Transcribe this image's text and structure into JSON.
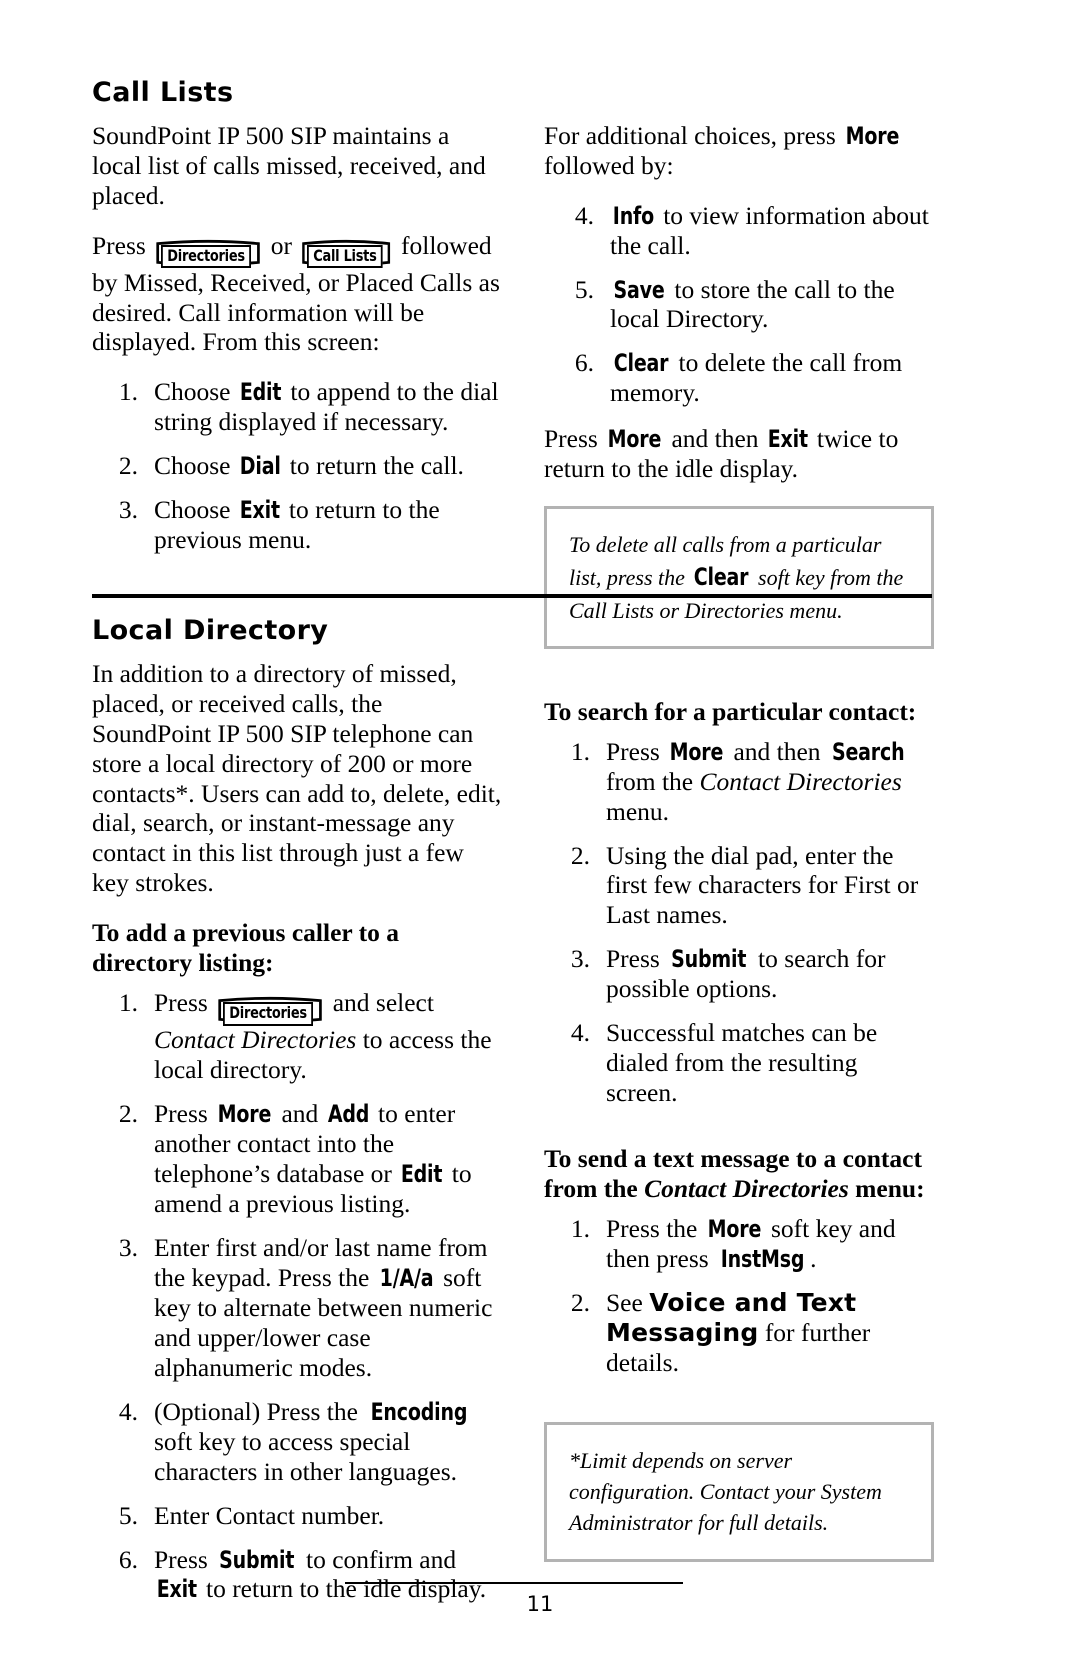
{
  "page": {
    "number": "11"
  },
  "call_lists": {
    "title": "Call Lists",
    "intro": "SoundPoint IP 500 SIP maintains a local list of calls missed, received, and placed.",
    "press_prefix": "Press",
    "key_directories": "Directories",
    "or": "or",
    "key_call_lists": "Call Lists",
    "press_suffix": "followed by Missed, Received, or Placed Calls as desired.  Call information will be displayed.  From this screen:",
    "steps": [
      {
        "num": "1.",
        "pre": "Choose ",
        "key": "Edit",
        "post": " to append to the dial string displayed if necessary."
      },
      {
        "num": "2.",
        "pre": "Choose ",
        "key": "Dial",
        "post": " to return the call."
      },
      {
        "num": "3.",
        "pre": "Choose ",
        "key": "Exit",
        "post": " to return to the previous menu."
      }
    ],
    "more_intro_pre": "For additional choices, press ",
    "more_intro_key": "More",
    "more_intro_post": " followed by:",
    "more_steps": [
      {
        "num": "4.",
        "key": "Info",
        "post": " to view information about the call."
      },
      {
        "num": "5.",
        "key": "Save",
        "post": " to store the call to the local Directory."
      },
      {
        "num": "6.",
        "key": "Clear",
        "post": " to delete the call from memory."
      }
    ],
    "closing_pre": "Press ",
    "closing_key1": "More",
    "closing_mid": " and then ",
    "closing_key2": "Exit",
    "closing_post": " twice to return to the idle display.",
    "note": {
      "pre": "To delete all calls from a particular list, press the ",
      "key": "Clear",
      "post": " soft key from the Call Lists or Directories menu."
    }
  },
  "local_directory": {
    "title": "Local Directory",
    "intro": "In addition to a directory of missed, placed, or received calls, the SoundPoint IP 500 SIP telephone can store a local directory of 200 or more contacts*.  Users can add to, delete, edit, dial, search, or instant-message any contact in this list through just a few key strokes.",
    "add_heading": "To add a previous caller to a directory listing:",
    "add_steps": [
      {
        "num": "1.",
        "pre": "Press ",
        "key_cap": "Directories",
        "mid": " and select ",
        "italic": "Contact Directories",
        "post": " to access the local directory."
      },
      {
        "num": "2.",
        "pre": "Press ",
        "key1": "More",
        "mid1": " and ",
        "key2": "Add",
        "mid2": " to enter another contact into the telephone’s database or ",
        "key3": "Edit",
        "post": " to amend a previous listing."
      },
      {
        "num": "3.",
        "pre": "Enter first and/or last name from the keypad.  Press the ",
        "key": "1/A/a",
        "post": " soft key to alternate between numeric and upper/lower case alphanumeric modes."
      },
      {
        "num": "4.",
        "pre": "(Optional)  Press the ",
        "key": "Encoding",
        "post": " soft key to access special characters in other languages."
      },
      {
        "num": "5.",
        "pre": "Enter Contact number.",
        "key": "",
        "post": ""
      },
      {
        "num": "6.",
        "pre": "Press ",
        "key1": "Submit",
        "mid1": " to confirm and ",
        "key2": "Exit",
        "post": " to return to the idle display."
      }
    ],
    "search_heading": "To search for a particular contact:",
    "search_steps": [
      {
        "num": "1.",
        "pre": "Press ",
        "key1": "More",
        "mid1": " and then ",
        "key2": "Search",
        "mid2": " from the ",
        "italic": "Contact Directories",
        "post": " menu."
      },
      {
        "num": "2.",
        "pre": "Using the dial pad, enter the first few characters for First or Last names.",
        "post": ""
      },
      {
        "num": "3.",
        "pre": "Press ",
        "key1": "Submit",
        "post": " to search for possible options."
      },
      {
        "num": "4.",
        "pre": "Successful matches can be dialed from the resulting screen.",
        "post": ""
      }
    ],
    "textmsg_heading_pre": "To send a text message to a contact from the ",
    "textmsg_heading_italic": "Contact Directories",
    "textmsg_heading_post": " menu:",
    "textmsg_steps": [
      {
        "num": "1.",
        "pre": "Press the ",
        "key1": "More",
        "mid1": " soft key and then press ",
        "key2": "InstMsg",
        "post": "."
      },
      {
        "num": "2.",
        "pre": "See ",
        "ref": "Voice and Text Messaging",
        "post": " for further details."
      }
    ],
    "note": {
      "text": "*Limit depends on server configuration.  Contact your System Administrator for full details."
    }
  }
}
